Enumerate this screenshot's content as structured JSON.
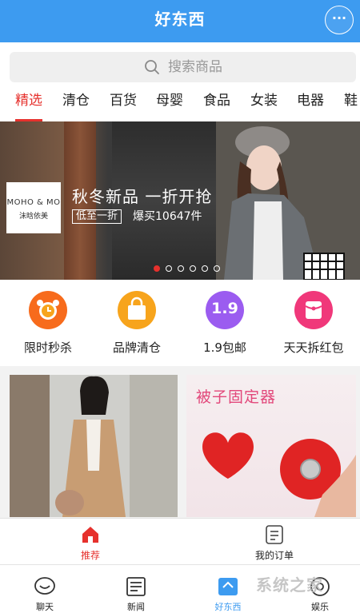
{
  "header": {
    "title": "好东西"
  },
  "search": {
    "placeholder": "搜索商品"
  },
  "tabs": [
    {
      "label": "精选",
      "active": true
    },
    {
      "label": "清仓"
    },
    {
      "label": "百货"
    },
    {
      "label": "母婴"
    },
    {
      "label": "食品"
    },
    {
      "label": "女装"
    },
    {
      "label": "电器"
    },
    {
      "label": "鞋"
    }
  ],
  "banner": {
    "brand_line1": "MOHO & MO",
    "brand_line2": "沫晗依美",
    "headline": "秋冬新品 一折开抢",
    "tag": "低至一折",
    "sold": "爆买10647件",
    "dots": 6,
    "active_dot": 0
  },
  "quick": [
    {
      "label": "限时秒杀",
      "icon": "alarm-clock-icon",
      "color": "#f76b1c"
    },
    {
      "label": "品牌清仓",
      "icon": "shopping-bag-icon",
      "color": "#f7a41c"
    },
    {
      "label": "1.9包邮",
      "icon": "price-tag-icon",
      "color": "#9b5cf0",
      "badge": "1.9"
    },
    {
      "label": "天天拆红包",
      "icon": "red-packet-icon",
      "color": "#f0387a"
    }
  ],
  "cards": {
    "right_title": "被子固定器"
  },
  "subnav": [
    {
      "label": "推荐",
      "icon": "home-icon",
      "active": true
    },
    {
      "label": "我的订单",
      "icon": "order-list-icon"
    }
  ],
  "nav": [
    {
      "label": "聊天",
      "icon": "chat-icon"
    },
    {
      "label": "新闻",
      "icon": "news-icon"
    },
    {
      "label": "好东西",
      "icon": "shop-icon",
      "active": true
    },
    {
      "label": "娱乐",
      "icon": "game-icon"
    }
  ],
  "watermark": "系统之家",
  "colors": {
    "primary": "#3d9bf0",
    "accent": "#e6312d"
  }
}
